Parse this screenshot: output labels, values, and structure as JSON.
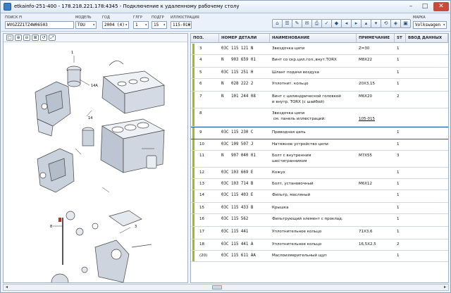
{
  "window": {
    "title": "etkainfo-251-400 - 178.218.221.178:4345 - Подключение к удаленному рабочему столу",
    "min": "–",
    "max": "□",
    "close": "✕"
  },
  "toolbar": {
    "search_label": "ПОИСК FI",
    "search_value": "WVGZZZ1TZ4W06503",
    "model_label": "МОДЕЛЬ",
    "model_value": "TOU",
    "year_label": "ГОД",
    "year_value": "2004 (4)",
    "group_label": "ГЛГР",
    "group_value": "1",
    "subgroup_label": "ПОДГР",
    "subgroup_value": "15",
    "illustration_label": "ИЛЛЮСТРАЦИЯ",
    "illustration_value": "115-010",
    "brand_label": "МАРКА",
    "brand_value": "Volkswagen",
    "buttons": [
      "⌂",
      "☰",
      "✎",
      "✉",
      "⎙",
      "✓",
      "◆",
      "◂",
      "▸",
      "▴",
      "▾",
      "⟲",
      "◈",
      "▣"
    ]
  },
  "left_tools": [
    "□",
    "⊕",
    "⊖",
    "⊞",
    "↺",
    "⤢"
  ],
  "illustration_callouts": [
    "14A",
    "14",
    "1",
    "3",
    "8"
  ],
  "table": {
    "headers": {
      "pos": "ПОЗ.",
      "num": "НОМЕР ДЕТАЛИ",
      "name": "НАИМЕНОВАНИЕ",
      "note": "ПРИМЕЧАНИЕ",
      "st": "ST",
      "data": "ВВОД ДАННЫХ"
    },
    "rows": [
      {
        "pos": "3",
        "num": "03C 115 121 N",
        "name": "Звездочка цепи",
        "note": "Z=30",
        "st": "1"
      },
      {
        "pos": "4",
        "num": "N   903 659 01",
        "name": "Винт со скр.цил.гол.,внут.TORX",
        "note": "M8X22",
        "st": "1"
      },
      {
        "pos": "5",
        "num": "03C 115 251 H",
        "name": "Шланг подачи воздуха",
        "note": "",
        "st": "1"
      },
      {
        "pos": "6",
        "num": "N   028 222 2",
        "name": "Уплотнит. кольцо",
        "note": "20X3,15",
        "st": "1"
      },
      {
        "pos": "7",
        "num": "N   101 244 08",
        "name": "Винт с цилиндрической головкой\nи внутр. TORX (с шайбой)",
        "note": "M6X20",
        "st": "2"
      },
      {
        "pos": "8",
        "num": "",
        "name": "Звездочка цепи\n см. панель иллюстраций:",
        "note": "105-015",
        "st": ""
      },
      {
        "pos": "9",
        "num": "03C 115 230 C",
        "name": "Приводная цепь",
        "note": "",
        "st": "1"
      },
      {
        "pos": "10",
        "num": "03C 109 507 J",
        "name": "Натяжное устройство цепи",
        "note": "",
        "st": "1"
      },
      {
        "pos": "11",
        "num": "N   907 040 01",
        "name": "Болт с внутренним\nшестигранником",
        "note": "M7X55",
        "st": "3"
      },
      {
        "pos": "12",
        "num": "03C 103 669 E",
        "name": "Кожух",
        "note": "",
        "st": "1"
      },
      {
        "pos": "13",
        "num": "03C 103 714 B",
        "name": "Болт, установочный",
        "note": "M6X12",
        "st": "1"
      },
      {
        "pos": "14",
        "num": "03C 115 403 E",
        "name": "Фильтр, масляный",
        "note": "",
        "st": "1"
      },
      {
        "pos": "15",
        "num": "03C 115 433 B",
        "name": "Крышка",
        "note": "",
        "st": "1"
      },
      {
        "pos": "16",
        "num": "03C 115 562",
        "name": "Фильтрующий элемент с проклад.",
        "note": "",
        "st": "1"
      },
      {
        "pos": "17",
        "num": "03C 115 441",
        "name": "Уплотнительное кольцо",
        "note": "71X3,6",
        "st": "1"
      },
      {
        "pos": "18",
        "num": "03C 115 441 A",
        "name": "Уплотнительное кольцо",
        "note": "16,5X2,5",
        "st": "2"
      },
      {
        "pos": "(20)",
        "num": "03C 115 611 AA",
        "name": "Маслоизмерительный щуп",
        "note": "",
        "st": "1"
      }
    ]
  },
  "scroll": {
    "left": "◂",
    "right": "▸"
  }
}
